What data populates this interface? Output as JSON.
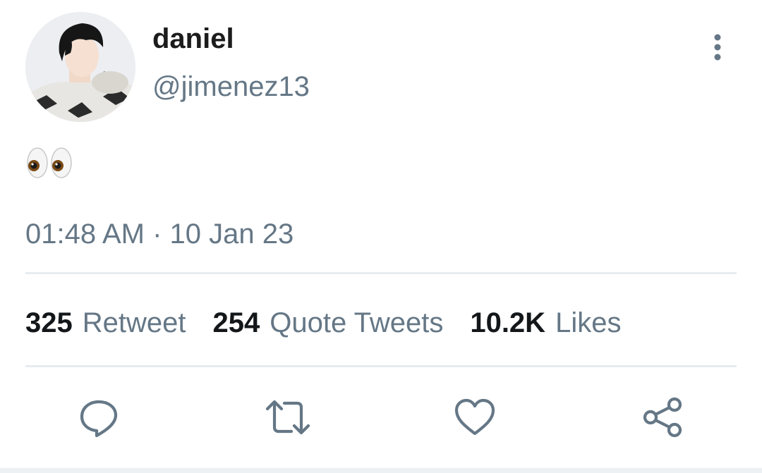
{
  "user": {
    "display_name": "daniel",
    "handle": "@jimenez13"
  },
  "tweet": {
    "text": "👀",
    "timestamp": "01:48 AM · 10 Jan 23"
  },
  "stats": {
    "retweets": {
      "count": "325",
      "label": "Retweet"
    },
    "quotes": {
      "count": "254",
      "label": "Quote Tweets"
    },
    "likes": {
      "count": "10.2K",
      "label": "Likes"
    }
  },
  "icons": {
    "more": "more-vertical-icon",
    "reply": "reply-icon",
    "retweet": "retweet-icon",
    "like": "heart-icon",
    "share": "share-icon"
  },
  "colors": {
    "secondary_text": "#657786",
    "icon": "#657786",
    "divider": "#e6ecf0"
  }
}
